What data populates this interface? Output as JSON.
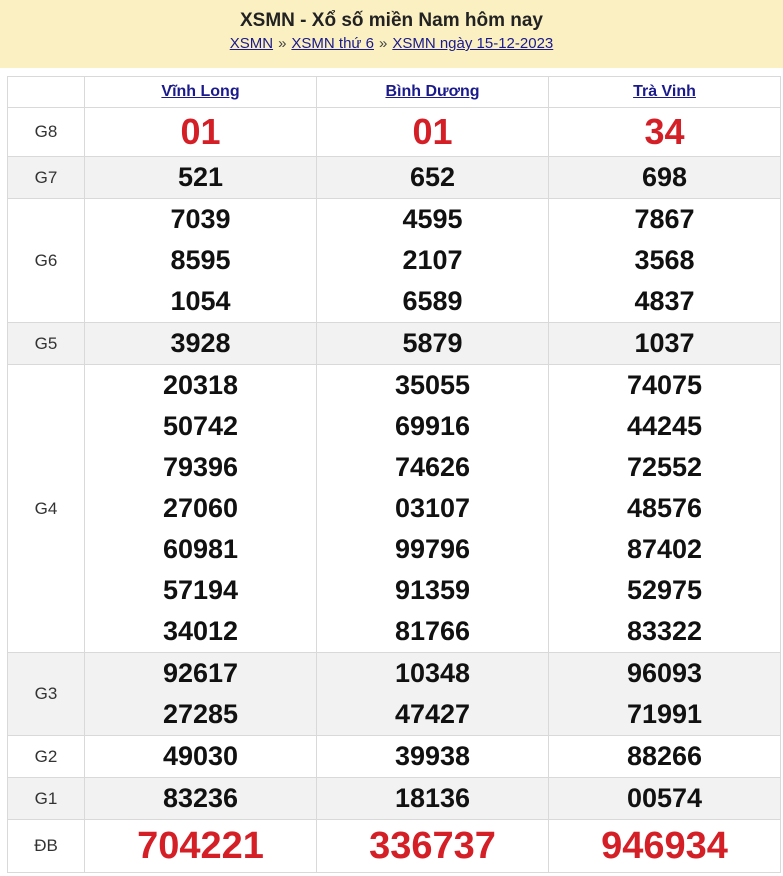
{
  "header": {
    "title": "XSMN - Xổ số miền Nam hôm nay",
    "crumbs": [
      "XSMN",
      "XSMN thứ 6",
      "XSMN ngày 15-12-2023"
    ],
    "separator": "»"
  },
  "provinces": [
    "Vĩnh Long",
    "Bình Dương",
    "Trà Vinh"
  ],
  "prizes": [
    {
      "label": "G8",
      "cols": [
        [
          "01"
        ],
        [
          "01"
        ],
        [
          "34"
        ]
      ]
    },
    {
      "label": "G7",
      "cols": [
        [
          "521"
        ],
        [
          "652"
        ],
        [
          "698"
        ]
      ]
    },
    {
      "label": "G6",
      "cols": [
        [
          "7039",
          "8595",
          "1054"
        ],
        [
          "4595",
          "2107",
          "6589"
        ],
        [
          "7867",
          "3568",
          "4837"
        ]
      ]
    },
    {
      "label": "G5",
      "cols": [
        [
          "3928"
        ],
        [
          "5879"
        ],
        [
          "1037"
        ]
      ]
    },
    {
      "label": "G4",
      "cols": [
        [
          "20318",
          "50742",
          "79396",
          "27060",
          "60981",
          "57194",
          "34012"
        ],
        [
          "35055",
          "69916",
          "74626",
          "03107",
          "99796",
          "91359",
          "81766"
        ],
        [
          "74075",
          "44245",
          "72552",
          "48576",
          "87402",
          "52975",
          "83322"
        ]
      ]
    },
    {
      "label": "G3",
      "cols": [
        [
          "92617",
          "27285"
        ],
        [
          "10348",
          "47427"
        ],
        [
          "96093",
          "71991"
        ]
      ]
    },
    {
      "label": "G2",
      "cols": [
        [
          "49030"
        ],
        [
          "39938"
        ],
        [
          "88266"
        ]
      ]
    },
    {
      "label": "G1",
      "cols": [
        [
          "83236"
        ],
        [
          "18136"
        ],
        [
          "00574"
        ]
      ]
    },
    {
      "label": "ĐB",
      "cols": [
        [
          "704221"
        ],
        [
          "336737"
        ],
        [
          "946934"
        ]
      ]
    }
  ],
  "colors": {
    "header_bg": "#fbf0c2",
    "special": "#d41f27",
    "link": "#1a1a8c",
    "alt_row": "#f2f2f2"
  }
}
